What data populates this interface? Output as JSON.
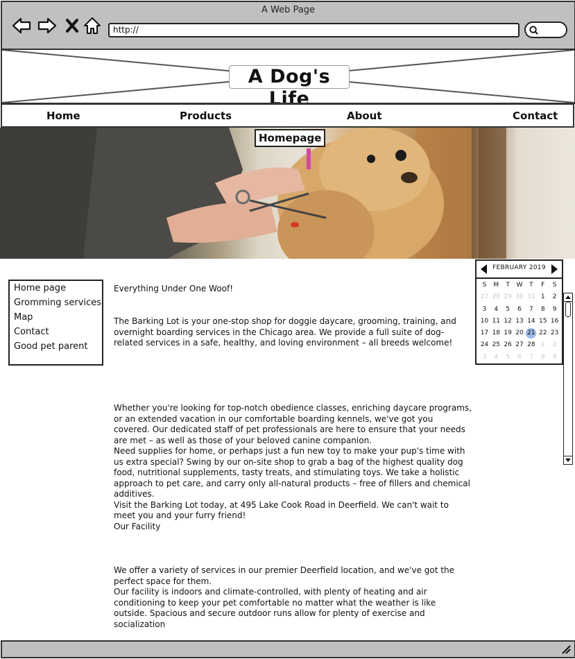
{
  "browser": {
    "window_title": "A Web Page",
    "url": "http://"
  },
  "site": {
    "title": "A Dog's Life"
  },
  "nav": {
    "items": [
      "Home",
      "Products",
      "About",
      "Contact"
    ]
  },
  "hero": {
    "label": "Homepage"
  },
  "sidebar": {
    "items": [
      "Home page",
      "Gromming services",
      "Map",
      "Contact",
      "Good pet parent"
    ]
  },
  "calendar": {
    "month_label": "FEBRUARY 2019",
    "weekdays": [
      "S",
      "M",
      "T",
      "W",
      "T",
      "F",
      "S"
    ],
    "weeks": [
      [
        "27",
        "28",
        "29",
        "30",
        "31",
        "1",
        "2"
      ],
      [
        "3",
        "4",
        "5",
        "6",
        "7",
        "8",
        "9"
      ],
      [
        "10",
        "11",
        "12",
        "13",
        "14",
        "15",
        "16"
      ],
      [
        "17",
        "18",
        "19",
        "20",
        "21",
        "22",
        "23"
      ],
      [
        "24",
        "25",
        "26",
        "27",
        "28",
        "1",
        "2"
      ],
      [
        "3",
        "4",
        "5",
        "6",
        "7",
        "8",
        "9"
      ]
    ],
    "selected_day": "21",
    "selection_color": "#9ab8e8"
  },
  "content": {
    "heading": "Everything Under One Woof!",
    "intro": "The Barking Lot is your one-stop shop for doggie daycare, grooming, training, and overnight boarding services in the Chicago area. We provide a full suite of dog-related services in a safe, healthy, and loving environment – all breeds welcome!",
    "para2": "Whether you're looking for top-notch obedience classes, enriching daycare programs, or an extended vacation in our comfortable boarding kennels, we've got you covered. Our dedicated staff of pet professionals are here to ensure that your needs are met – as well as those of your beloved canine companion.",
    "para3": "Need supplies for home, or perhaps just a fun new toy to make your pup's time with us extra special? Swing by our on-site shop to grab a bag of the highest quality dog food, nutritional supplements, tasty treats, and stimulating toys. We take a holistic approach to pet care, and carry only all-natural products – free of fillers and chemical additives.",
    "para4": "Visit the Barking Lot today, at 495 Lake Cook Road in Deerfield. We can't wait to meet you and your furry friend!",
    "facility_heading": "Our Facility",
    "para5": "We offer a variety of services in our premier Deerfield location, and we've got the perfect space for them.",
    "para6": "Our facility is indoors and climate-controlled, with plenty of heating and air conditioning to keep your pet comfortable no matter what the weather is like outside. Spacious and secure outdoor runs allow for plenty of exercise and socialization"
  }
}
